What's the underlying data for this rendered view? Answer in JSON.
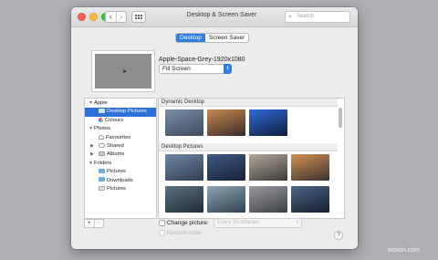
{
  "window": {
    "title": "Desktop & Screen Saver",
    "search_placeholder": "Search",
    "nav_back": "‹",
    "nav_forward": "›"
  },
  "tabs": [
    {
      "label": "Desktop",
      "active": true
    },
    {
      "label": "Screen Saver",
      "active": false
    }
  ],
  "current": {
    "wallpaper_name": "Apple-Space-Grey-1920x1080",
    "fill_mode": "Fill Screen"
  },
  "sidebar": {
    "apple": {
      "label": "Apple",
      "items": [
        "Desktop Pictures",
        "Colours"
      ]
    },
    "photos": {
      "label": "Photos",
      "items": [
        "Favourites",
        "Shared",
        "Albums"
      ]
    },
    "folders": {
      "label": "Folders",
      "items": [
        "Pictures",
        "Downloads",
        "Pictures"
      ]
    },
    "selected": "Desktop Pictures"
  },
  "gallery": {
    "dynamic_desktop": {
      "header": "Dynamic Desktop",
      "thumbs": [
        {
          "icon": "catalina-island-day",
          "colors": [
            "#7a8fa8",
            "#3c4a5c"
          ]
        },
        {
          "icon": "mojave-dunes",
          "colors": [
            "#c98a4e",
            "#3a2b2a"
          ]
        },
        {
          "icon": "solar-gradient",
          "colors": [
            "#2f6bd8",
            "#0f1d3c"
          ]
        }
      ]
    },
    "desktop_pictures": {
      "header": "Desktop Pictures",
      "thumbs": [
        {
          "icon": "catalina-island",
          "colors": [
            "#6f87a4",
            "#2f3f52"
          ]
        },
        {
          "icon": "catalina-evening",
          "colors": [
            "#3f5a86",
            "#152236"
          ]
        },
        {
          "icon": "catalina-rock",
          "colors": [
            "#b3a99a",
            "#3b3a38"
          ]
        },
        {
          "icon": "catalina-sunset",
          "colors": [
            "#d39253",
            "#3a3030"
          ]
        },
        {
          "icon": "catalina-coast",
          "colors": [
            "#5b7280",
            "#1f2c36"
          ]
        },
        {
          "icon": "catalina-shore",
          "colors": [
            "#8fa6b5",
            "#2e4150"
          ]
        },
        {
          "icon": "catalina-clouds",
          "colors": [
            "#9a9a9f",
            "#3c3f46"
          ]
        },
        {
          "icon": "catalina-night",
          "colors": [
            "#4c6688",
            "#141e2c"
          ]
        }
      ]
    }
  },
  "bottom": {
    "add_label": "+",
    "remove_label": "−",
    "change_picture_label": "Change picture:",
    "interval": "Every 30 minutes",
    "random_label": "Random order",
    "help_label": "?"
  },
  "watermark": "wsxdn.com",
  "colors": {
    "accent": "#2f7de1",
    "desktop_bg": "#aeafb4"
  }
}
